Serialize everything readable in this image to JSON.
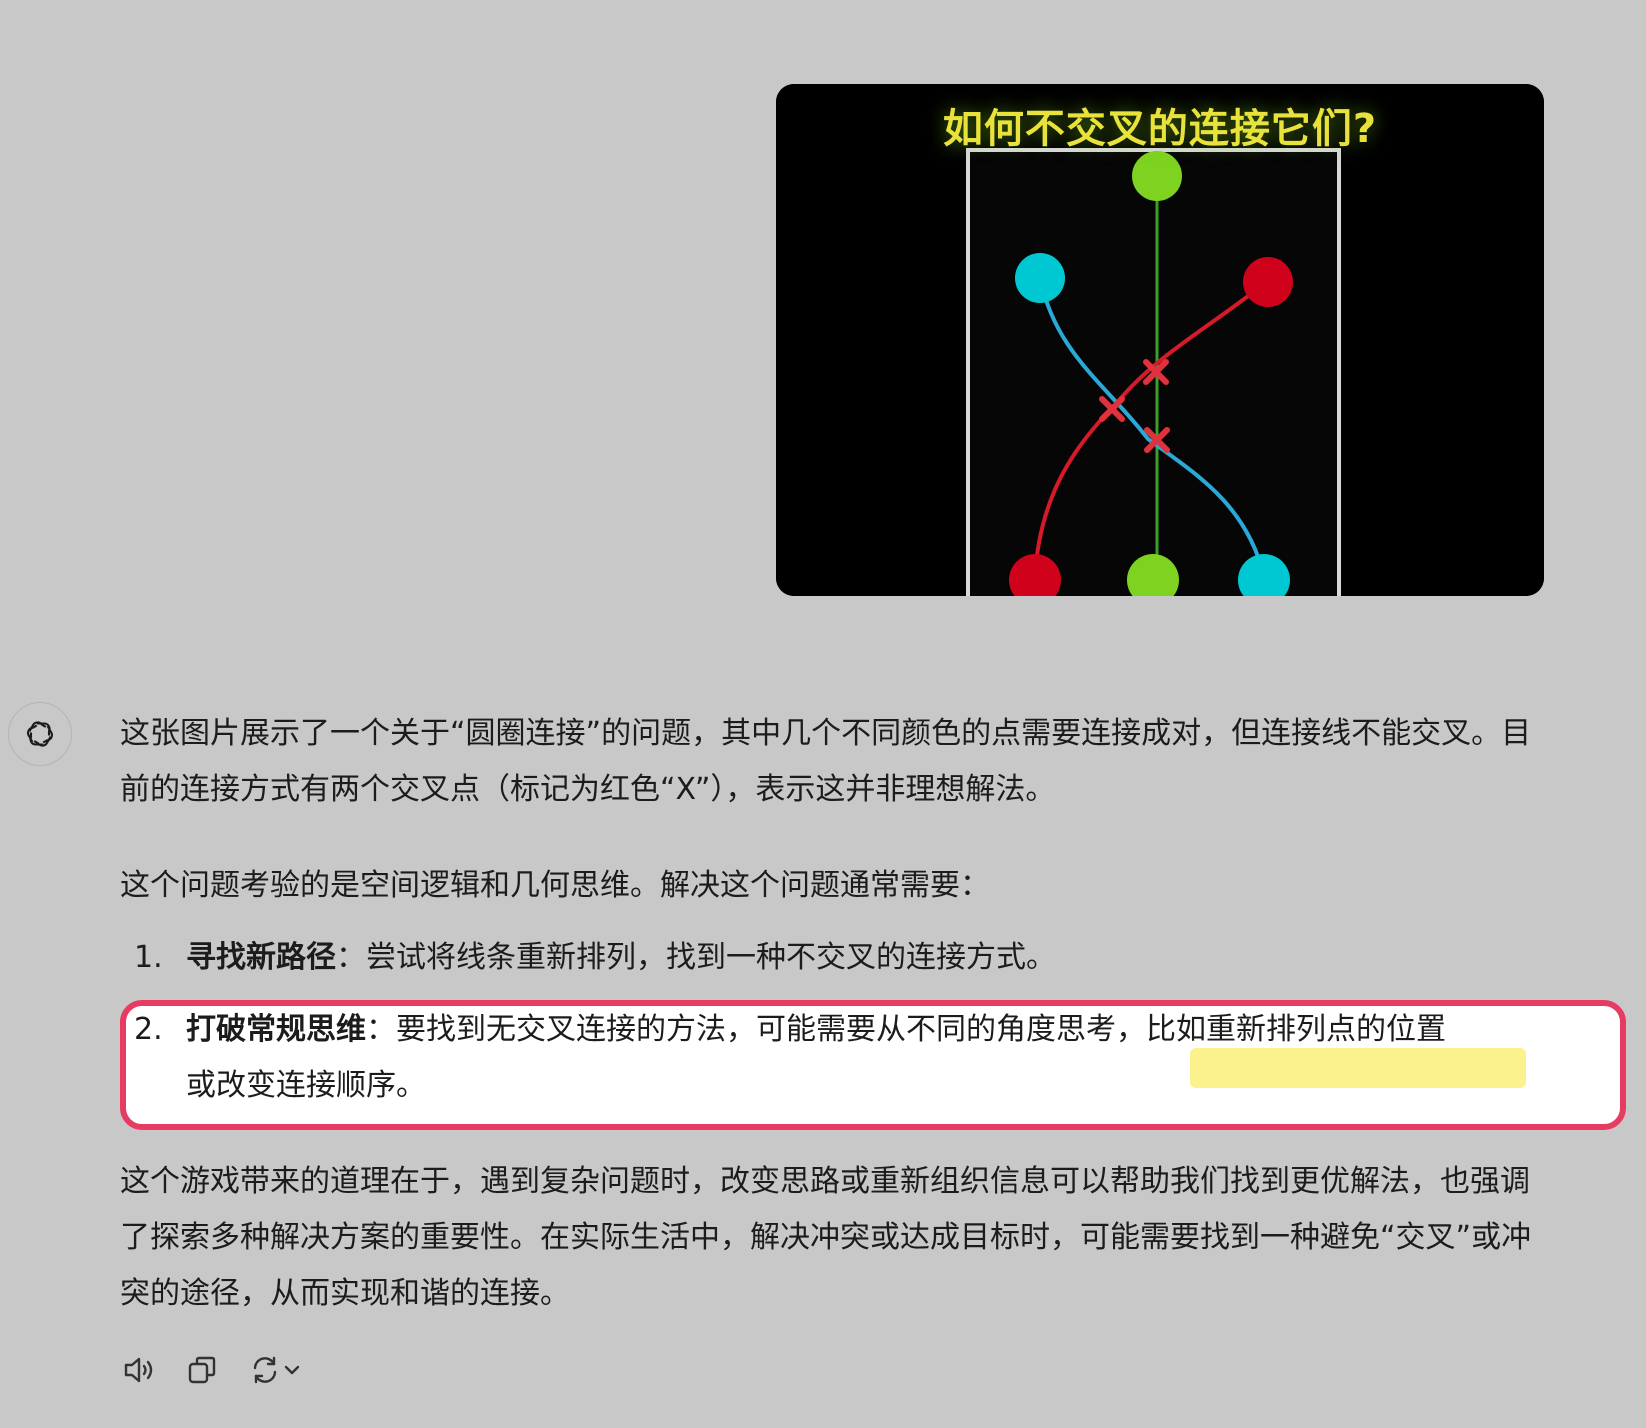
{
  "user_image": {
    "title": "如何不交叉的连接它们?",
    "colors": {
      "green": "#7ed321",
      "cyan": "#00c8d2",
      "red": "#d0021b",
      "marker": "#e0323c"
    }
  },
  "assistant": {
    "avatar_icon": "openai-logo-icon",
    "paragraph_1": "这张图片展示了一个关于“圆圈连接”的问题，其中几个不同颜色的点需要连接成对，但连接线不能交叉。目前的连接方式有两个交叉点（标记为红色“X”），表示这并非理想解法。",
    "paragraph_2": "这个问题考验的是空间逻辑和几何思维。解决这个问题通常需要：",
    "list": [
      {
        "number": "1.",
        "term": "寻找新路径",
        "text": "：尝试将线条重新排列，找到一种不交叉的连接方式。"
      },
      {
        "number": "2.",
        "term": "打破常规思维",
        "text_line1": "：要找到无交叉连接的方法，可能需要从不同的角度思考，比如重新排列点的位置",
        "text_line2": "或改变连接顺序。"
      }
    ],
    "paragraph_3": "这个游戏带来的道理在于，遇到复杂问题时，改变思路或重新组织信息可以帮助我们找到更优解法，也强调了探索多种解决方案的重要性。在实际生活中，解决冲突或达成目标时，可能需要找到一种避免“交叉”或冲突的途径，从而实现和谐的连接。"
  },
  "annotations": {
    "box_color": "#e73c62",
    "highlight_color": "#fbf28e"
  },
  "toolbar": {
    "icons": [
      "speaker-icon",
      "copy-icon",
      "regenerate-icon",
      "chevron-down-icon"
    ]
  }
}
